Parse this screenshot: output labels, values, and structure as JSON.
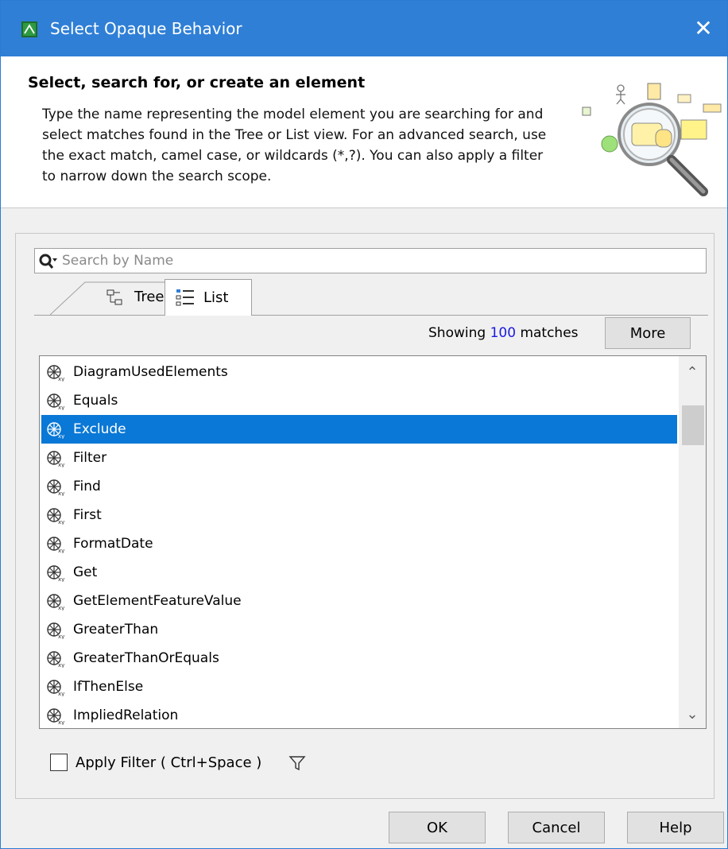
{
  "window": {
    "title": "Select Opaque Behavior",
    "close_label": "✕"
  },
  "header": {
    "title": "Select, search for, or create an element",
    "description": "Type the name representing the model element you are searching for and select matches found in the Tree or List view. For an advanced search, use the exact match, camel case, or wildcards (*,?). You can also apply a filter to narrow down the search scope."
  },
  "search": {
    "placeholder": "Search by Name",
    "value": ""
  },
  "tabs": [
    {
      "label": "Tree",
      "icon": "tree-icon"
    },
    {
      "label": "List",
      "icon": "list-icon",
      "active": true
    }
  ],
  "matches": {
    "prefix": "Showing",
    "count": "100",
    "suffix": "matches",
    "more_label": "More"
  },
  "list": {
    "items": [
      {
        "label": "DiagramUsedElements",
        "icon": "opaque-behavior-icon"
      },
      {
        "label": "Equals",
        "icon": "opaque-behavior-icon"
      },
      {
        "label": "Exclude",
        "icon": "opaque-behavior-icon",
        "selected": true
      },
      {
        "label": "Filter",
        "icon": "opaque-behavior-icon"
      },
      {
        "label": "Find",
        "icon": "opaque-behavior-icon"
      },
      {
        "label": "First",
        "icon": "opaque-behavior-icon"
      },
      {
        "label": "FormatDate",
        "icon": "opaque-behavior-icon"
      },
      {
        "label": "Get",
        "icon": "opaque-behavior-icon"
      },
      {
        "label": "GetElementFeatureValue",
        "icon": "opaque-behavior-icon"
      },
      {
        "label": "GreaterThan",
        "icon": "opaque-behavior-icon"
      },
      {
        "label": "GreaterThanOrEquals",
        "icon": "opaque-behavior-icon"
      },
      {
        "label": "IfThenElse",
        "icon": "opaque-behavior-icon"
      },
      {
        "label": "ImpliedRelation",
        "icon": "opaque-behavior-icon"
      }
    ]
  },
  "filter": {
    "label": "Apply Filter ( Ctrl+Space )",
    "checked": false
  },
  "buttons": {
    "ok": "OK",
    "cancel": "Cancel",
    "help": "Help"
  },
  "colors": {
    "titlebar": "#2f7fd6",
    "selection": "#0a78d6",
    "match_count": "#1a1adf"
  }
}
